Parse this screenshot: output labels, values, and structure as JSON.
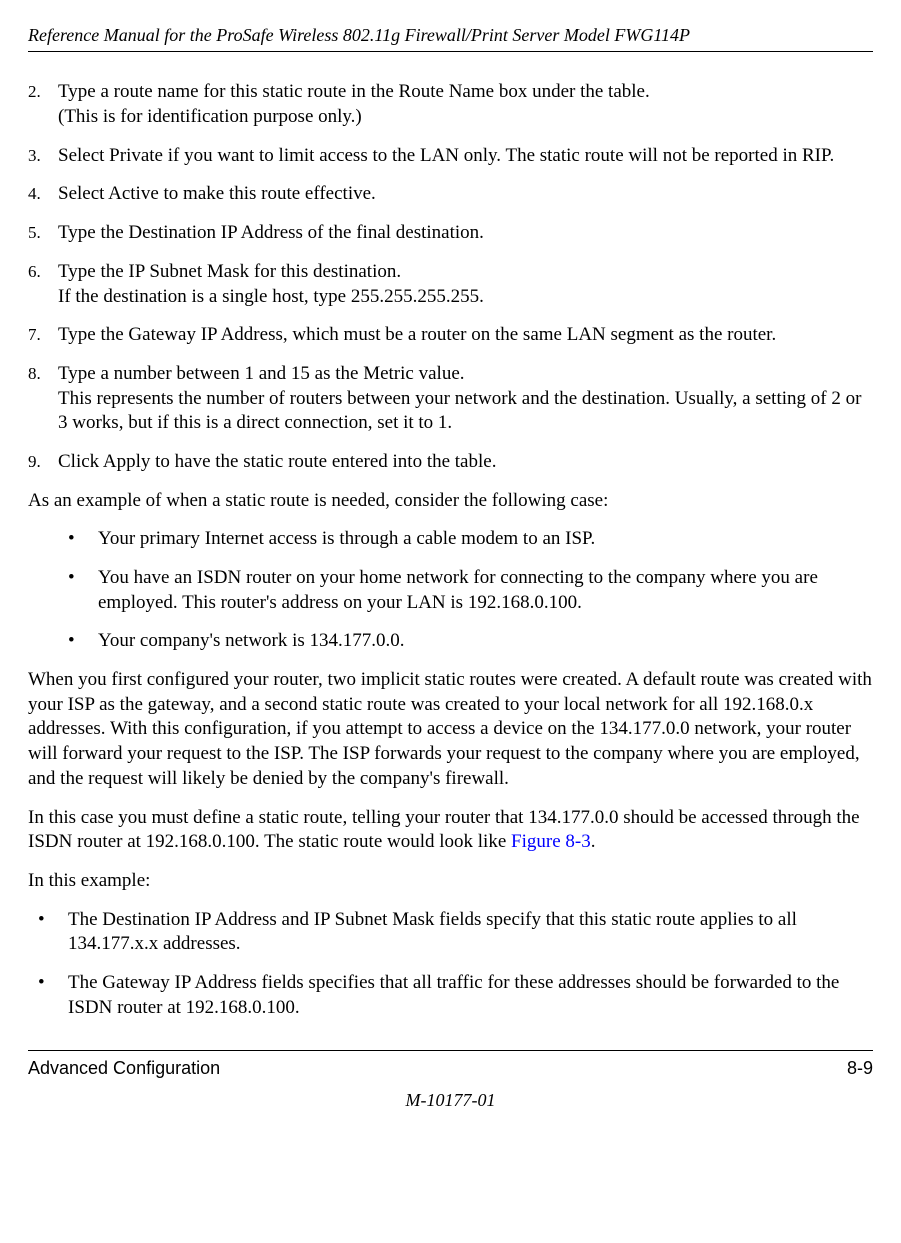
{
  "header": {
    "title": "Reference Manual for the ProSafe Wireless 802.11g  Firewall/Print Server Model FWG114P"
  },
  "steps": [
    {
      "num": "2.",
      "text": "Type a route name for this static route in the Route Name box under the table.\n(This is for identification purpose only.)"
    },
    {
      "num": "3.",
      "text": "Select Private if you want to limit access to the LAN only. The static route will not be reported in RIP."
    },
    {
      "num": "4.",
      "text": "Select Active to make this route effective."
    },
    {
      "num": "5.",
      "text": "Type the Destination IP Address of the final destination."
    },
    {
      "num": "6.",
      "text": "Type the IP Subnet Mask for this destination.\nIf the destination is a single host, type 255.255.255.255."
    },
    {
      "num": "7.",
      "text": "Type the Gateway IP Address, which must be a router on the same LAN segment as the router."
    },
    {
      "num": "8.",
      "text": "Type a number between 1 and 15 as the Metric value.\nThis represents the number of routers between your network and the destination. Usually, a setting of 2 or 3 works, but if this is a direct connection, set it to 1."
    },
    {
      "num": "9.",
      "text": "Click Apply to have the static route entered into the table."
    }
  ],
  "para1": "As an example of when a static route is needed, consider the following case:",
  "inner_bullets": [
    "Your primary Internet access is through a cable modem to an ISP.",
    "You have an ISDN router on your home network for connecting to the company where you are employed. This router's address on your LAN is 192.168.0.100.",
    "Your company's network is 134.177.0.0."
  ],
  "para2": "When you first configured your router, two implicit static routes were created. A default route was created with your ISP as the gateway, and a second static route was created to your local network for all 192.168.0.x addresses. With this configuration, if you attempt to access a device on the 134.177.0.0 network, your router will forward your request to the ISP. The ISP forwards your request to the company where you are employed, and the request will likely be denied by the company's firewall.",
  "para3_pre": "In this case you must define a static route, telling your router that 134.177.0.0 should be accessed through the ISDN router at 192.168.0.100. The static route would look like ",
  "para3_link": "Figure 8-3",
  "para3_post": ".",
  "para4": "In this example:",
  "outer_bullets": [
    "The Destination IP Address and IP Subnet Mask fields specify that this static route applies to all 134.177.x.x addresses.",
    "The Gateway IP Address fields specifies that all traffic for these addresses should be forwarded to the ISDN router at 192.168.0.100."
  ],
  "footer": {
    "section": "Advanced Configuration",
    "page": "8-9",
    "docnum": "M-10177-01"
  }
}
